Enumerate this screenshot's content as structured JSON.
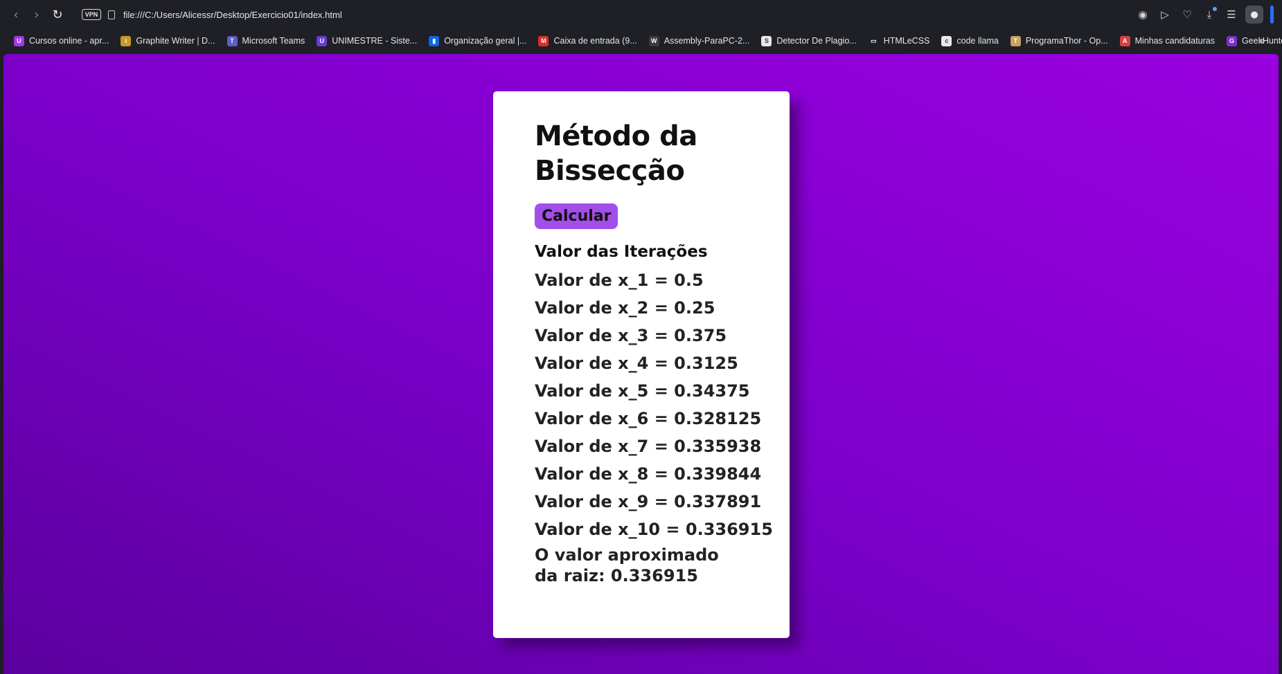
{
  "browser": {
    "url": "file:///C:/Users/Alicessr/Desktop/Exercicio01/index.html",
    "vpn_label": "VPN",
    "bookmarks": [
      {
        "label": "Cursos online - apr...",
        "icon": "udemy-icon",
        "color": "#a435f0",
        "glyph": "U"
      },
      {
        "label": "Graphite Writer | D...",
        "icon": "graphite-icon",
        "color": "#c79a2a",
        "glyph": "i"
      },
      {
        "label": "Microsoft Teams",
        "icon": "teams-icon",
        "color": "#5b5fc7",
        "glyph": "T"
      },
      {
        "label": "UNIMESTRE - Siste...",
        "icon": "unimestre-icon",
        "color": "#6a3bd6",
        "glyph": "U"
      },
      {
        "label": "Organização geral |...",
        "icon": "trello-icon",
        "color": "#0c66e4",
        "glyph": "▮"
      },
      {
        "label": "Caixa de entrada (9...",
        "icon": "gmail-icon",
        "color": "#d93025",
        "glyph": "M"
      },
      {
        "label": "Assembly-ParaPC-2...",
        "icon": "wordpress-icon",
        "color": "#3c3c3c",
        "glyph": "W"
      },
      {
        "label": "Detector De Plagio...",
        "icon": "sst-icon",
        "color": "#e8e8e8",
        "glyph": "S"
      },
      {
        "label": "HTMLeCSS",
        "icon": "folder-icon",
        "color": "#1f2026",
        "glyph": "▭"
      },
      {
        "label": "code llama",
        "icon": "page-icon",
        "color": "#e8e8e8",
        "glyph": "c"
      },
      {
        "label": "ProgramaThor - Op...",
        "icon": "hammer-icon",
        "color": "#c8a060",
        "glyph": "T"
      },
      {
        "label": "Minhas candidaturas",
        "icon": "candidaturas-icon",
        "color": "#d94040",
        "glyph": "A"
      },
      {
        "label": "GeekHunter",
        "icon": "geekhunter-icon",
        "color": "#7b2fd0",
        "glyph": "G"
      }
    ]
  },
  "page": {
    "title": "Método da Bissecção",
    "button_label": "Calcular",
    "section_title": "Valor das Iterações",
    "iterations": [
      "Valor de x_1 = 0.5",
      "Valor de x_2 = 0.25",
      "Valor de x_3 = 0.375",
      "Valor de x_4 = 0.3125",
      "Valor de x_5 = 0.34375",
      "Valor de x_6 = 0.328125",
      "Valor de x_7 = 0.335938",
      "Valor de x_8 = 0.339844",
      "Valor de x_9 = 0.337891",
      "Valor de x_10 = 0.336915"
    ],
    "result": "O valor aproximado da raiz: 0.336915"
  }
}
